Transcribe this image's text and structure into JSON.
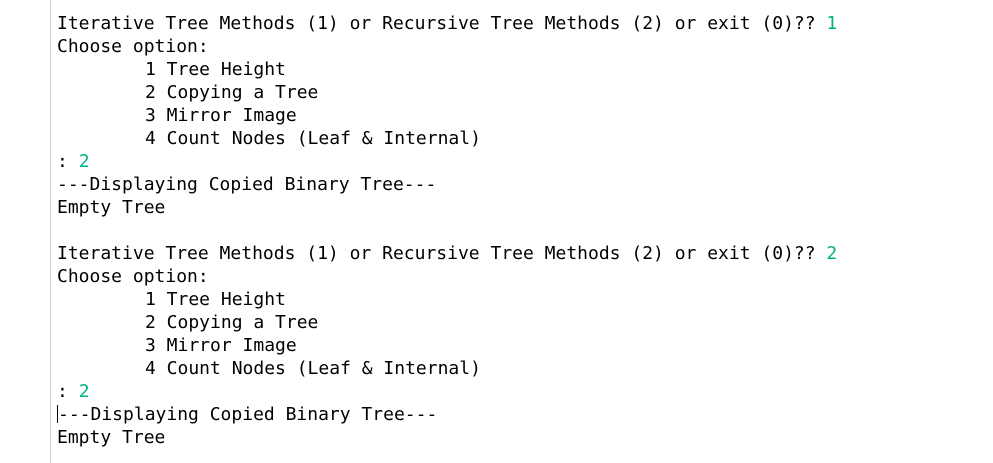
{
  "console": {
    "block1": {
      "prompt": "Iterative Tree Methods (1) or Recursive Tree Methods (2) or exit (0)?? ",
      "prompt_input": "1",
      "choose": "Choose option:",
      "options": [
        "1 Tree Height",
        "2 Copying a Tree",
        "3 Mirror Image",
        "4 Count Nodes (Leaf & Internal)"
      ],
      "option_prompt": ": ",
      "option_input": "2",
      "result_header": "---Displaying Copied Binary Tree---",
      "result": "Empty Tree"
    },
    "block2": {
      "prompt": "Iterative Tree Methods (1) or Recursive Tree Methods (2) or exit (0)?? ",
      "prompt_input": "2",
      "choose": "Choose option:",
      "options": [
        "1 Tree Height",
        "2 Copying a Tree",
        "3 Mirror Image",
        "4 Count Nodes (Leaf & Internal)"
      ],
      "option_prompt": ": ",
      "option_input": "2",
      "result_header": "---Displaying Copied Binary Tree---",
      "result": "Empty Tree"
    }
  },
  "colors": {
    "user_input": "#00b386",
    "text": "#000000",
    "background": "#ffffff"
  }
}
